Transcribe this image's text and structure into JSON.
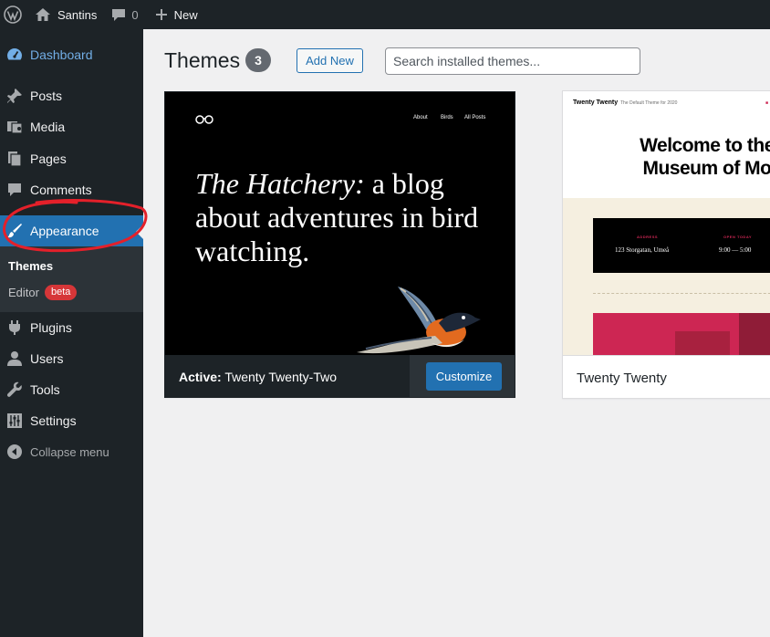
{
  "adminbar": {
    "site_name": "Santins",
    "comments_count": "0",
    "new_label": "New"
  },
  "sidebar": {
    "dashboard": "Dashboard",
    "posts": "Posts",
    "media": "Media",
    "pages": "Pages",
    "comments": "Comments",
    "appearance": "Appearance",
    "submenu": {
      "themes": "Themes",
      "editor": "Editor",
      "editor_badge": "beta"
    },
    "plugins": "Plugins",
    "users": "Users",
    "tools": "Tools",
    "settings": "Settings",
    "collapse": "Collapse menu"
  },
  "main": {
    "title": "Themes",
    "count": "3",
    "add_new": "Add New",
    "search_placeholder": "Search installed themes..."
  },
  "themes": [
    {
      "preview": {
        "nav": [
          "About",
          "Birds",
          "All Posts"
        ],
        "hero_italic": "The Hatchery:",
        "hero_rest": "a blog about adventures in bird watching."
      },
      "active_prefix": "Active:",
      "name": "Twenty Twenty-Two",
      "action": "Customize"
    },
    {
      "preview": {
        "brand": "Twenty Twenty",
        "tagline": "The Default Theme for 2020",
        "title": "Welcome to the Museum of Mo",
        "address_label": "ADDRESS",
        "address_value": "123 Storgatan, Umeå",
        "open_label": "OPEN TODAY",
        "open_value": "9:00 — 5:00"
      },
      "name": "Twenty Twenty"
    }
  ],
  "colors": {
    "adminbar_bg": "#1d2327",
    "accent": "#2271b1",
    "badge_red": "#d63638",
    "annotation": "#e4202a"
  }
}
